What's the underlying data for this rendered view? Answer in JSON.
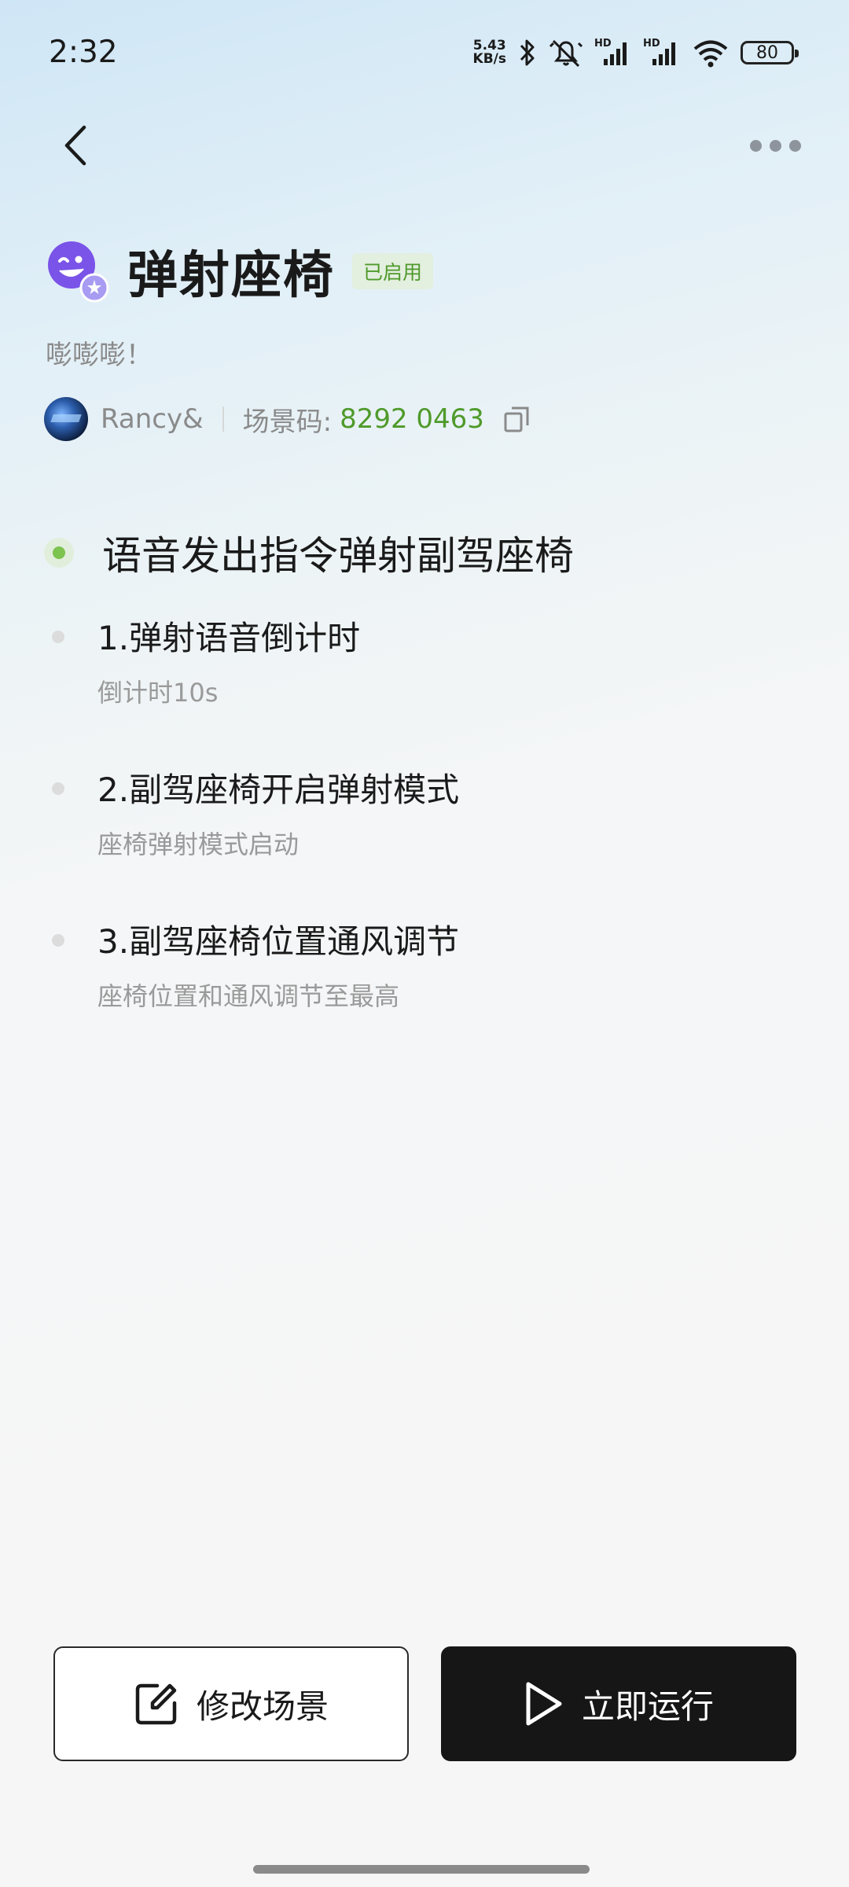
{
  "status_bar": {
    "time": "2:32",
    "net_speed_value": "5.43",
    "net_speed_unit": "KB/s",
    "battery": "80",
    "signal_label_1": "HD",
    "signal_label_2": "HD"
  },
  "scene": {
    "title": "弹射座椅",
    "status": "已启用",
    "description": "嘭嘭嘭！",
    "author": "Rancy&",
    "code_label": "场景码:",
    "code_value": "8292 0463"
  },
  "trigger": {
    "text": "语音发出指令弹射副驾座椅"
  },
  "steps": [
    {
      "title": "1.弹射语音倒计时",
      "desc": "倒计时10s"
    },
    {
      "title": "2.副驾座椅开启弹射模式",
      "desc": "座椅弹射模式启动"
    },
    {
      "title": "3.副驾座椅位置通风调节",
      "desc": "座椅位置和通风调节至最高"
    }
  ],
  "buttons": {
    "edit": "修改场景",
    "run": "立即运行"
  },
  "colors": {
    "accent_green": "#4f9a2b",
    "badge_bg": "#e3efdf",
    "run_button_bg": "#161616",
    "scene_icon_purple": "#7a53e8"
  },
  "icons": {
    "back": "chevron-left-icon",
    "more": "more-dots-icon",
    "copy": "copy-icon",
    "edit": "edit-icon",
    "run": "play-icon"
  }
}
